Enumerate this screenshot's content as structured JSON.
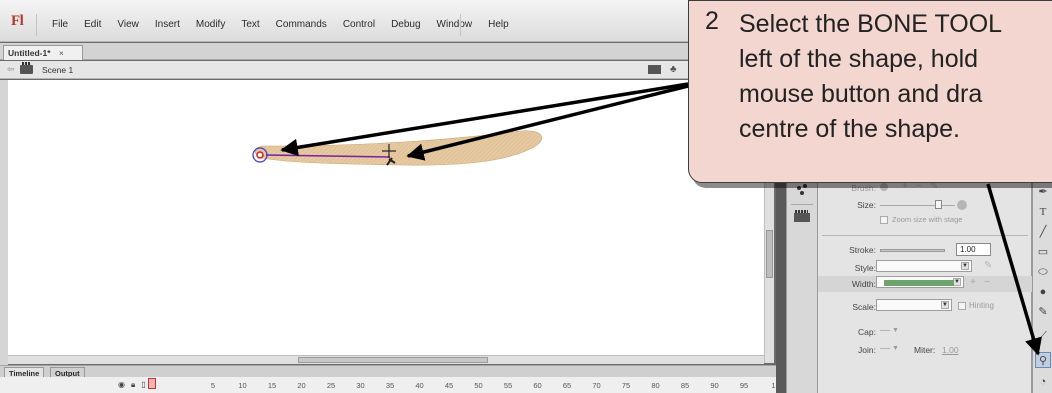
{
  "app": {
    "logo": "Fl"
  },
  "menu": [
    "File",
    "Edit",
    "View",
    "Insert",
    "Modify",
    "Text",
    "Commands",
    "Control",
    "Debug",
    "Window",
    "Help"
  ],
  "document_tab": {
    "label": "Untitled-1*",
    "close": "×"
  },
  "edit_bar": {
    "scene_label": "Scene 1"
  },
  "timeline": {
    "tabs": [
      "Timeline",
      "Output"
    ],
    "frame_numbers": [
      "5",
      "10",
      "15",
      "20",
      "25",
      "30",
      "35",
      "40",
      "45",
      "50",
      "55",
      "60",
      "65",
      "70",
      "75",
      "80",
      "85",
      "90",
      "95",
      "1"
    ]
  },
  "properties": {
    "brush_label": "Brush:",
    "size_label": "Size:",
    "zoom_size_label": "Zoom size with stage",
    "stroke_label": "Stroke:",
    "stroke_value": "1.00",
    "style_label": "Style:",
    "width_label": "Width:",
    "scale_label": "Scale:",
    "hinting_label": "Hinting",
    "cap_label": "Cap:",
    "join_label": "Join:",
    "miter_label": "Miter:",
    "miter_value": "1.00"
  },
  "callout": {
    "step": "2",
    "text": "Select the BONE TOOL\nleft of the shape, hold\nmouse button and dra\ncentre of the shape."
  },
  "colors": {
    "shape_fill": "#e6c9a1",
    "bone_line": "#7a1ea8",
    "callout_bg": "#f2d6cf",
    "width_swatch": "#6ba56b",
    "stage_bg": "#ffffff"
  },
  "icons": {
    "scene": "clapperboard-icon",
    "back": "back-arrow-icon",
    "bone_tool": "bone-tool-icon"
  }
}
